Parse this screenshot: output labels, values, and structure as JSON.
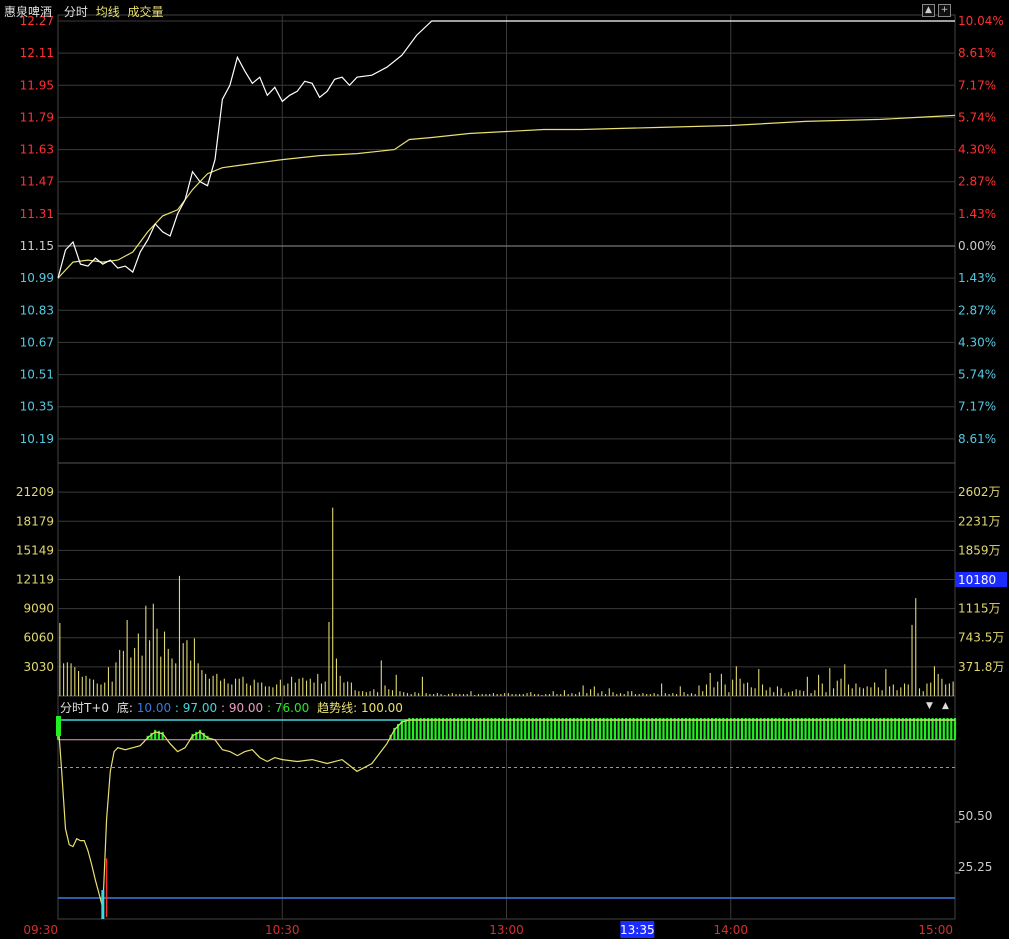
{
  "header": {
    "stock_name": "惠泉啤酒",
    "mode": "分时",
    "avg_label": "均线",
    "vol_label": "成交量"
  },
  "indicator": {
    "name": "分时T+0",
    "bottom_label": "底:",
    "v1": "10.00",
    "v2": ": 97.00",
    "v3": ": 90.00",
    "v4": ": 76.00",
    "trend_label": "趋势线:",
    "trend_value": "100.00",
    "level_labels": [
      "50.50",
      "25.25"
    ]
  },
  "colors": {
    "price": "#ffffff",
    "avg": "#e8e070",
    "up": "#ff3030",
    "down": "#55c8e0",
    "grid": "#3a3a3a",
    "zero": "#777777",
    "vol": "#e0d870",
    "green": "#22ee22",
    "cyan": "#40d8e0",
    "pink": "#e8a0c0",
    "blue_line": "#3a7ae0"
  },
  "current_volume_tag": "10180",
  "cursor_time": "13:35",
  "chart_data": [
    {
      "type": "line",
      "title": "",
      "ylim": [
        10.03,
        12.27
      ],
      "prev_close": 11.15,
      "y_ticks_left": [
        "12.27",
        "12.11",
        "11.95",
        "11.79",
        "11.63",
        "11.47",
        "11.31",
        "11.15",
        "10.99",
        "10.83",
        "10.67",
        "10.51",
        "10.35",
        "10.19"
      ],
      "y_ticks_right": [
        "10.04%",
        "8.61%",
        "7.17%",
        "5.74%",
        "4.30%",
        "2.87%",
        "1.43%",
        "0.00%",
        "1.43%",
        "2.87%",
        "4.30%",
        "5.74%",
        "7.17%",
        "8.61%"
      ],
      "x_ticks": [
        "09:30",
        "10:30",
        "13:00",
        "14:00",
        "15:00"
      ],
      "series": [
        {
          "name": "分时",
          "x": [
            0,
            2,
            4,
            6,
            8,
            10,
            12,
            14,
            16,
            18,
            20,
            22,
            24,
            26,
            28,
            30,
            32,
            34,
            36,
            38,
            40,
            42,
            44,
            46,
            48,
            50,
            52,
            54,
            56,
            58,
            60,
            62,
            64,
            66,
            68,
            70,
            72,
            74,
            76,
            78,
            80,
            84,
            88,
            92,
            96,
            100,
            110,
            120,
            130,
            140,
            150,
            160,
            170,
            180,
            190,
            200,
            210,
            220,
            230,
            240
          ],
          "values": [
            10.99,
            11.13,
            11.17,
            11.06,
            11.05,
            11.09,
            11.06,
            11.08,
            11.04,
            11.05,
            11.02,
            11.12,
            11.18,
            11.26,
            11.22,
            11.2,
            11.31,
            11.38,
            11.52,
            11.47,
            11.45,
            11.58,
            11.88,
            11.95,
            12.09,
            12.02,
            11.96,
            11.99,
            11.9,
            11.94,
            11.87,
            11.9,
            11.92,
            11.97,
            11.96,
            11.89,
            11.92,
            11.98,
            11.99,
            11.95,
            11.99,
            12.0,
            12.04,
            12.1,
            12.2,
            12.27,
            12.27,
            12.27,
            12.27,
            12.27,
            12.27,
            12.27,
            12.27,
            12.27,
            12.27,
            12.27,
            12.27,
            12.27,
            12.27,
            12.27
          ]
        },
        {
          "name": "均线",
          "x": [
            0,
            4,
            8,
            12,
            16,
            20,
            24,
            28,
            32,
            36,
            40,
            44,
            48,
            52,
            56,
            60,
            70,
            80,
            90,
            94,
            100,
            110,
            120,
            130,
            140,
            160,
            180,
            200,
            220,
            230,
            240
          ],
          "values": [
            10.99,
            11.07,
            11.08,
            11.07,
            11.08,
            11.12,
            11.22,
            11.3,
            11.33,
            11.43,
            11.51,
            11.54,
            11.55,
            11.56,
            11.57,
            11.58,
            11.6,
            11.61,
            11.63,
            11.68,
            11.69,
            11.71,
            11.72,
            11.73,
            11.73,
            11.74,
            11.75,
            11.77,
            11.78,
            11.79,
            11.8
          ]
        }
      ]
    },
    {
      "type": "bar",
      "title": "成交量",
      "ylim": [
        0,
        24239
      ],
      "y_ticks_left": [
        "21209",
        "18179",
        "15149",
        "12119",
        "9090",
        "6060",
        "3030"
      ],
      "y_ticks_right": [
        "2602万",
        "2231万",
        "1859万",
        "1487万",
        "1115万",
        "743.5万",
        "371.8万"
      ],
      "series": [
        {
          "name": "成交量",
          "values": [
            7600,
            3400,
            3500,
            3400,
            3000,
            2600,
            2000,
            2100,
            1800,
            1700,
            1300,
            1200,
            1400,
            3000,
            1500,
            3500,
            4800,
            4700,
            7900,
            4000,
            5000,
            6500,
            4200,
            9400,
            5800,
            9600,
            7000,
            4100,
            6700,
            4900,
            3900,
            3400,
            12500,
            5500,
            5800,
            3700,
            6000,
            3400,
            2700,
            2300,
            1800,
            2100,
            2300,
            1600,
            1800,
            1300,
            1200,
            1800,
            1800,
            2000,
            1300,
            1100,
            1700,
            1400,
            1400,
            1000,
            1000,
            900,
            1200,
            1700,
            1100,
            1300,
            2000,
            1400,
            1800,
            1900,
            1600,
            1800,
            1400,
            2300,
            1300,
            1500,
            7700,
            19600,
            3900,
            2100,
            1400,
            1500,
            1400,
            600,
            500,
            500,
            400,
            500,
            700,
            400,
            3700,
            1100,
            700,
            600,
            2200,
            500,
            400,
            300,
            200,
            400,
            300,
            2000,
            300,
            200,
            200,
            300,
            200,
            100,
            200,
            300,
            200,
            200,
            200,
            200,
            500,
            100,
            200,
            200,
            200,
            200,
            300,
            200,
            200,
            300,
            300,
            200,
            200,
            200,
            200,
            300,
            400,
            200,
            200,
            100,
            200,
            200,
            500,
            200,
            200,
            600,
            200,
            300,
            200,
            400,
            1100,
            300,
            700,
            1000,
            300,
            500,
            200,
            800,
            400,
            200,
            300,
            200,
            500,
            500,
            200,
            200,
            300,
            200,
            200,
            300,
            200,
            1300,
            300,
            200,
            300,
            200,
            1000,
            400,
            200,
            300,
            200,
            1100,
            500,
            1200,
            2400,
            900,
            1500,
            2300,
            1200,
            400,
            1700,
            3100,
            1800,
            1300,
            1400,
            900,
            800,
            2800,
            1200,
            600,
            900,
            400,
            1000,
            800,
            300,
            400,
            500,
            700,
            600,
            500,
            2000,
            300,
            600,
            2200,
            1300,
            400,
            2900,
            800,
            1600,
            1800,
            3300,
            1200,
            800,
            1300,
            900,
            800,
            1000,
            900,
            1400,
            900,
            600,
            2800,
            1000,
            1200,
            600,
            900,
            1300,
            1200,
            7400,
            10180,
            800,
            500,
            1300,
            1400,
            3100,
            2300,
            1800,
            1200,
            1300,
            1500
          ]
        }
      ]
    },
    {
      "type": "line",
      "title": "分时T+0",
      "ylim": [
        0,
        101
      ],
      "levels": {
        "top": 100,
        "pink": 90,
        "dash": 76,
        "bottom": 10
      },
      "series": [
        {
          "name": "趋势线",
          "x": [
            0,
            1,
            2,
            3,
            4,
            5,
            6,
            7,
            8,
            9,
            10,
            11,
            12,
            13,
            14,
            15,
            16,
            18,
            20,
            22,
            24,
            26,
            28,
            30,
            32,
            34,
            36,
            38,
            40,
            42,
            44,
            46,
            48,
            50,
            52,
            54,
            56,
            58,
            60,
            64,
            68,
            72,
            76,
            80,
            84,
            88,
            90,
            92,
            94,
            96,
            100,
            120,
            150,
            180,
            210,
            240
          ],
          "values": [
            100,
            74,
            45,
            37,
            36,
            40,
            39,
            39,
            34,
            27,
            19,
            12,
            5,
            50,
            74,
            84,
            86,
            85,
            86,
            87,
            91,
            94,
            93,
            88,
            84,
            86,
            92,
            94,
            91,
            90,
            85,
            84,
            82,
            84,
            85,
            81,
            79,
            81,
            80,
            79,
            80,
            78,
            80,
            74,
            78,
            88,
            95,
            99,
            100,
            100,
            100,
            100,
            100,
            100,
            100,
            100
          ]
        }
      ]
    }
  ]
}
